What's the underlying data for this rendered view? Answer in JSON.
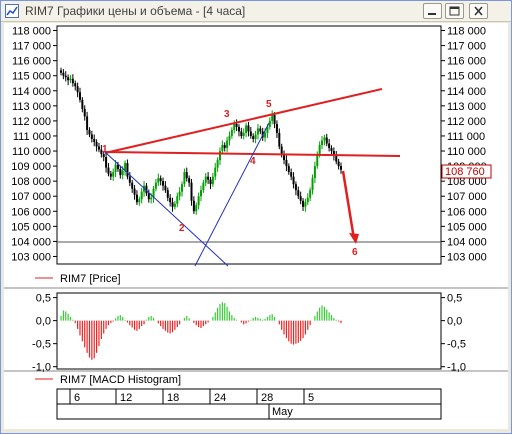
{
  "window": {
    "title": "RIM7 Графики цены и объема - [4 часа]"
  },
  "price_panel": {
    "legend": "RIM7 [Price]",
    "current_price": "108 760",
    "y_ticks": [
      "118 000",
      "117 000",
      "116 000",
      "115 000",
      "114 000",
      "113 000",
      "112 000",
      "111 000",
      "110 000",
      "109 000",
      "108 000",
      "107 000",
      "106 000",
      "105 000",
      "104 000",
      "103 000"
    ],
    "pattern_labels": [
      "1",
      "2",
      "3",
      "4",
      "5",
      "6"
    ]
  },
  "macd_panel": {
    "legend": "RIM7 [MACD Histogram]",
    "y_ticks": [
      "0,5",
      "0,0",
      "-0,5",
      "-1,0"
    ]
  },
  "time_axis": {
    "day_labels": [
      "6",
      "12",
      "18",
      "24",
      "28",
      "5"
    ],
    "month_label": "May"
  },
  "colors": {
    "bull": "#00a000",
    "bear": "#000000",
    "annotation": "#e02020",
    "fan_line": "#2030c0",
    "macd_pos": "#33cc33",
    "macd_neg": "#ee2222"
  },
  "chart_data": [
    {
      "type": "candlestick",
      "title": "",
      "series_name": "RIM7 [Price]",
      "ylim": [
        102500,
        118300
      ],
      "close": [
        115200,
        115000,
        114900,
        114700,
        114800,
        114500,
        114300,
        113900,
        113400,
        112800,
        112300,
        111400,
        111100,
        110800,
        110600,
        110300,
        110100,
        109800,
        109600,
        108900,
        108500,
        108300,
        108600,
        109100,
        108800,
        108400,
        108700,
        109200,
        108300,
        107900,
        107500,
        107100,
        106600,
        106800,
        107300,
        107700,
        107200,
        106800,
        106900,
        107500,
        107900,
        108200,
        108000,
        107700,
        107400,
        106900,
        106600,
        106300,
        106500,
        107000,
        107300,
        107800,
        108600,
        108200,
        107900,
        106700,
        106000,
        106400,
        107000,
        107400,
        107900,
        108300,
        108100,
        107800,
        108300,
        108900,
        109400,
        110000,
        110400,
        110200,
        110700,
        111000,
        111400,
        111800,
        111600,
        111300,
        111000,
        111200,
        111700,
        111300,
        111000,
        110800,
        111100,
        111500,
        111300,
        110900,
        111200,
        111600,
        112000,
        112400,
        111800,
        111200,
        110300,
        109800,
        109400,
        109000,
        108600,
        108300,
        107800,
        107400,
        107000,
        106700,
        106300,
        106600,
        106900,
        107400,
        108200,
        109000,
        109800,
        110400,
        110700,
        110900,
        110500,
        110200,
        110000,
        109700,
        109300,
        109000,
        108760
      ],
      "annotations": [
        {
          "label": "1",
          "price": 110100
        },
        {
          "label": "2",
          "price": 105500
        },
        {
          "label": "3",
          "price": 111700
        },
        {
          "label": "4",
          "price": 109600
        },
        {
          "label": "5",
          "price": 112700
        },
        {
          "label": "6",
          "price": 103700
        }
      ],
      "horizontal_lines": [
        110000,
        104100
      ]
    },
    {
      "type": "bar",
      "title": "",
      "series_name": "RIM7 [MACD Histogram]",
      "ylim": [
        -1.05,
        0.6
      ],
      "values": [
        0.1,
        0.22,
        0.2,
        0.15,
        0.08,
        0.02,
        -0.05,
        -0.18,
        -0.32,
        -0.45,
        -0.58,
        -0.7,
        -0.8,
        -0.85,
        -0.82,
        -0.7,
        -0.55,
        -0.4,
        -0.28,
        -0.18,
        -0.1,
        -0.05,
        -0.02,
        0.05,
        0.1,
        0.12,
        0.08,
        0.02,
        -0.04,
        -0.1,
        -0.15,
        -0.2,
        -0.22,
        -0.18,
        -0.12,
        -0.08,
        0.02,
        0.08,
        0.1,
        0.06,
        0.0,
        -0.06,
        -0.12,
        -0.18,
        -0.22,
        -0.26,
        -0.28,
        -0.25,
        -0.2,
        -0.14,
        -0.08,
        0.0,
        0.06,
        0.1,
        0.05,
        0.0,
        -0.05,
        -0.1,
        -0.14,
        -0.16,
        -0.12,
        -0.08,
        -0.04,
        0.0,
        0.08,
        0.18,
        0.28,
        0.36,
        0.4,
        0.38,
        0.3,
        0.2,
        0.12,
        0.06,
        0.02,
        0.0,
        -0.04,
        -0.08,
        -0.06,
        -0.02,
        0.02,
        0.06,
        0.08,
        0.06,
        0.04,
        0.02,
        0.04,
        0.08,
        0.12,
        0.14,
        0.08,
        0.0,
        -0.08,
        -0.2,
        -0.3,
        -0.38,
        -0.45,
        -0.5,
        -0.52,
        -0.5,
        -0.48,
        -0.44,
        -0.38,
        -0.3,
        -0.2,
        -0.1,
        0.0,
        0.1,
        0.2,
        0.28,
        0.33,
        0.3,
        0.24,
        0.18,
        0.12,
        0.06,
        0.02,
        -0.02,
        -0.05
      ]
    }
  ]
}
